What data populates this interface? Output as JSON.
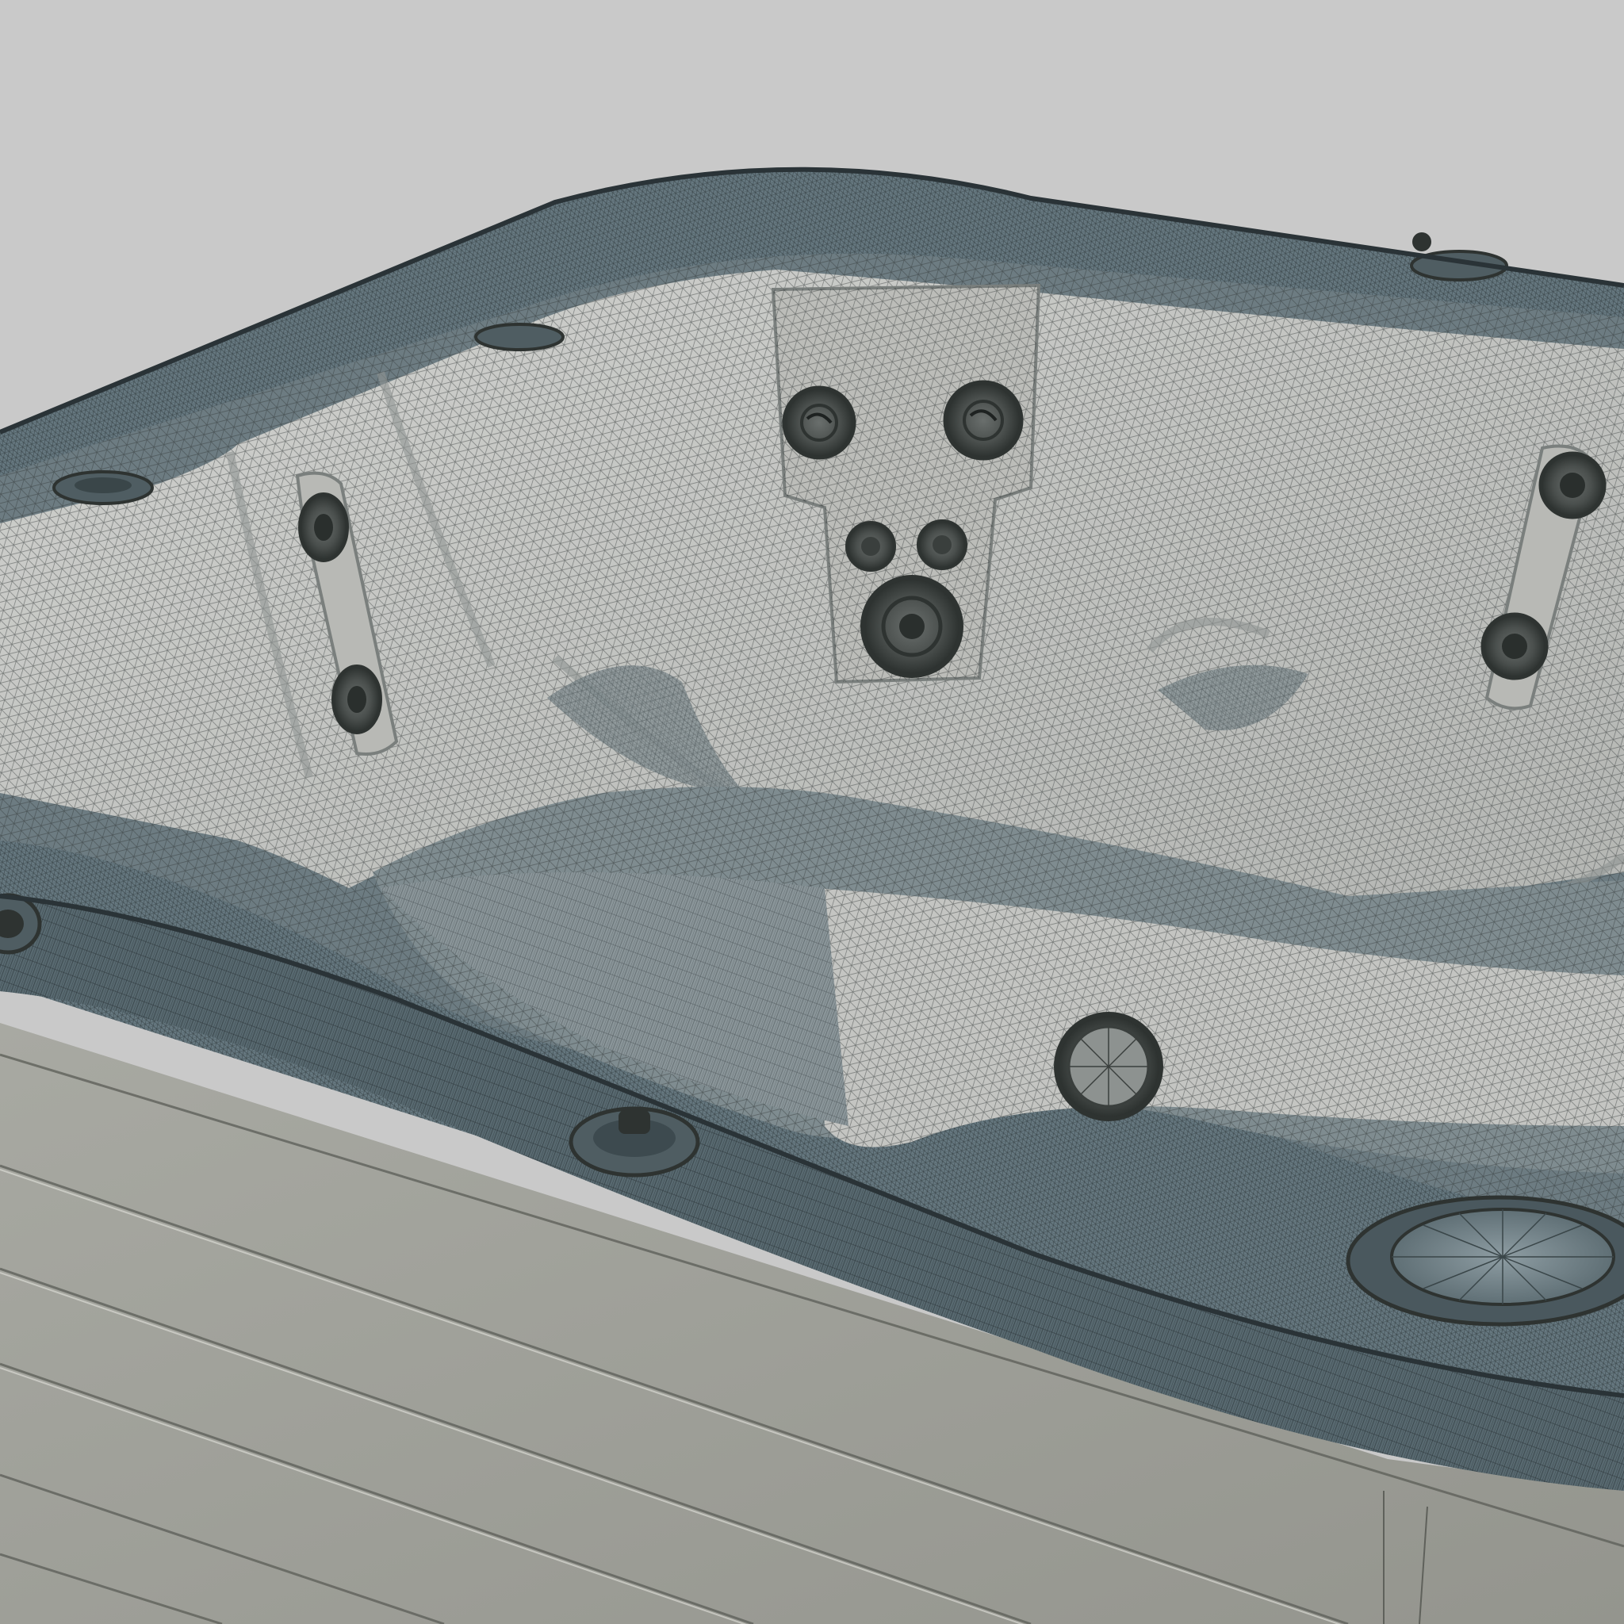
{
  "scene": {
    "subject": "hot-tub-wireframe-render",
    "colors": {
      "background": "#c9c9c9",
      "cabinet": "#9fa099",
      "cabinet_line": "#5f615b",
      "rim": "#667880",
      "rim_dark": "#3f4c52",
      "shell": "#c2c3c0",
      "shell_shadow": "#8f9593",
      "well": "#6d7c82",
      "jet": "#4f5352",
      "jet_ring": "#2e3331",
      "mesh": "#2f3535"
    },
    "icons": [
      "jet-icon",
      "control-valve-icon",
      "filter-lid-icon",
      "drain-icon",
      "cup-holder-icon"
    ]
  }
}
